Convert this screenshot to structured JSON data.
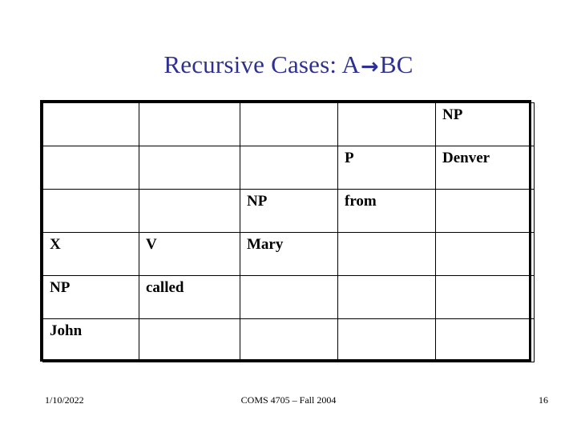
{
  "slide": {
    "title_prefix": "Recursive Cases: A",
    "title_arrow": "→",
    "title_suffix": "BC"
  },
  "colors": {
    "title": "#2E3192",
    "nonterminal": "#000000",
    "word": "#1A6B1A",
    "highlight": "#7B1030",
    "border": "#000000",
    "background": "#FFFFFF"
  },
  "chart_data": {
    "type": "table",
    "title": "Recursive Cases: A→BC",
    "rows": 6,
    "columns": 5,
    "grid": "on",
    "cells": [
      [
        {
          "text": "",
          "tone": "black"
        },
        {
          "text": "",
          "tone": "black"
        },
        {
          "text": "",
          "tone": "black"
        },
        {
          "text": "",
          "tone": "black"
        },
        {
          "text": "NP",
          "tone": "black"
        }
      ],
      [
        {
          "text": "",
          "tone": "black"
        },
        {
          "text": "",
          "tone": "black"
        },
        {
          "text": "",
          "tone": "black"
        },
        {
          "text": "P",
          "tone": "black"
        },
        {
          "text": "Denver",
          "tone": "green"
        }
      ],
      [
        {
          "text": "",
          "tone": "black"
        },
        {
          "text": "",
          "tone": "black"
        },
        {
          "text": "NP",
          "tone": "black"
        },
        {
          "text": "from",
          "tone": "green"
        },
        {
          "text": "",
          "tone": "black"
        }
      ],
      [
        {
          "text": "X",
          "tone": "maroon"
        },
        {
          "text": "V",
          "tone": "black"
        },
        {
          "text": "Mary",
          "tone": "green"
        },
        {
          "text": "",
          "tone": "black"
        },
        {
          "text": "",
          "tone": "black"
        }
      ],
      [
        {
          "text": "NP",
          "tone": "black"
        },
        {
          "text": "called",
          "tone": "green"
        },
        {
          "text": "",
          "tone": "black"
        },
        {
          "text": "",
          "tone": "black"
        },
        {
          "text": "",
          "tone": "black"
        }
      ],
      [
        {
          "text": "John",
          "tone": "green"
        },
        {
          "text": "",
          "tone": "black"
        },
        {
          "text": "",
          "tone": "black"
        },
        {
          "text": "",
          "tone": "black"
        },
        {
          "text": "",
          "tone": "black"
        }
      ]
    ]
  },
  "footer": {
    "date": "1/10/2022",
    "course": "COMS 4705 – Fall 2004",
    "page_number": "16"
  }
}
